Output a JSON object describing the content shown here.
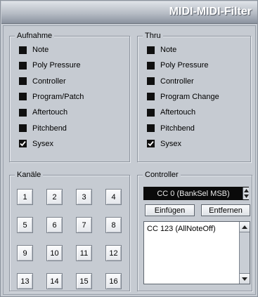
{
  "window": {
    "title": "MIDI-MIDI-Filter"
  },
  "record": {
    "legend": "Aufnahme",
    "items": [
      {
        "label": "Note",
        "checked": false
      },
      {
        "label": "Poly Pressure",
        "checked": false
      },
      {
        "label": "Controller",
        "checked": false
      },
      {
        "label": "Program/Patch",
        "checked": false
      },
      {
        "label": "Aftertouch",
        "checked": false
      },
      {
        "label": "Pitchbend",
        "checked": false
      },
      {
        "label": "Sysex",
        "checked": true
      }
    ]
  },
  "thru": {
    "legend": "Thru",
    "items": [
      {
        "label": "Note",
        "checked": false
      },
      {
        "label": "Poly Pressure",
        "checked": false
      },
      {
        "label": "Controller",
        "checked": false
      },
      {
        "label": "Program Change",
        "checked": false
      },
      {
        "label": "Aftertouch",
        "checked": false
      },
      {
        "label": "Pitchbend",
        "checked": false
      },
      {
        "label": "Sysex",
        "checked": true
      }
    ]
  },
  "channels": {
    "legend": "Kanäle",
    "buttons": [
      "1",
      "2",
      "3",
      "4",
      "5",
      "6",
      "7",
      "8",
      "9",
      "10",
      "11",
      "12",
      "13",
      "14",
      "15",
      "16"
    ]
  },
  "controller": {
    "legend": "Controller",
    "selected": "CC 0  (BankSel MSB)",
    "insert_label": "Einfügen",
    "remove_label": "Entfernen",
    "list": [
      "CC 123  (AllNoteOff)"
    ]
  },
  "icons": {
    "check": "checkmark-icon",
    "spin": "up-down-arrows-icon",
    "scroll_up": "scroll-up-arrow-icon",
    "scroll_down": "scroll-down-arrow-icon"
  }
}
